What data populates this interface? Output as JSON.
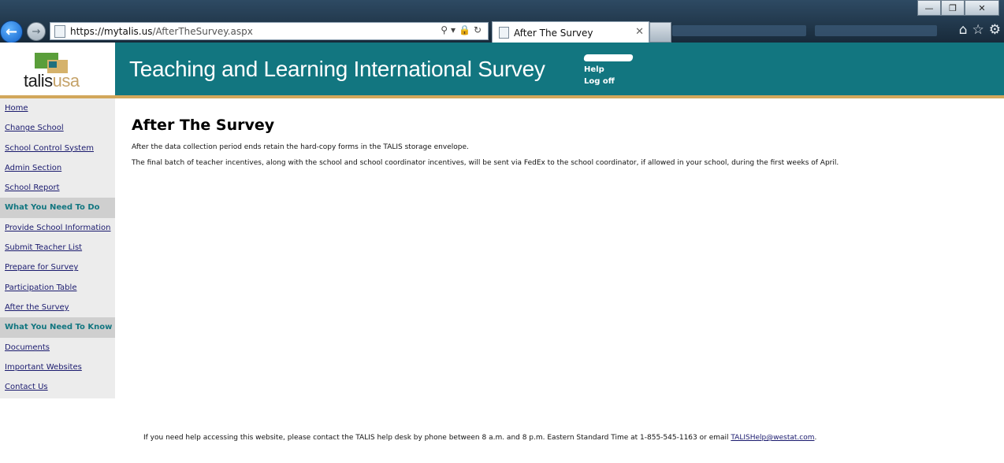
{
  "browser": {
    "url_host": "https://mytalis.us",
    "url_path": "/AfterTheSurvey.aspx",
    "tab_title": "After The Survey",
    "window_controls": [
      "minimize",
      "restore",
      "close"
    ],
    "toolbar_icons": [
      "home-icon",
      "star-icon",
      "gear-icon"
    ]
  },
  "logo": {
    "prefix": "talis",
    "suffix": "usa"
  },
  "header": {
    "title": "Teaching and Learning International Survey",
    "links": {
      "help": "Help",
      "logoff": "Log off"
    }
  },
  "sidebar": {
    "items": [
      {
        "label": "Home",
        "type": "link"
      },
      {
        "label": "Change School",
        "type": "link"
      },
      {
        "label": "School Control System",
        "type": "link"
      },
      {
        "label": "Admin Section",
        "type": "link"
      },
      {
        "label": "School Report",
        "type": "link"
      },
      {
        "label": "What You Need To Do",
        "type": "heading"
      },
      {
        "label": "Provide School Information",
        "type": "link"
      },
      {
        "label": "Submit Teacher List",
        "type": "link"
      },
      {
        "label": "Prepare for Survey",
        "type": "link"
      },
      {
        "label": "Participation Table",
        "type": "link"
      },
      {
        "label": "After the Survey",
        "type": "link"
      },
      {
        "label": "What You Need To Know",
        "type": "heading"
      },
      {
        "label": "Documents",
        "type": "link"
      },
      {
        "label": "Important Websites",
        "type": "link"
      },
      {
        "label": "Contact Us",
        "type": "link"
      }
    ]
  },
  "main": {
    "title": "After The Survey",
    "paragraphs": [
      "After the data collection period ends retain the hard-copy forms in the TALIS storage envelope.",
      "The final batch of teacher incentives, along with the school and school coordinator incentives, will be sent via FedEx to the school coordinator, if allowed in your school, during the first weeks of April."
    ]
  },
  "footer": {
    "text": "If you need help accessing this website, please contact the TALIS help desk by phone between 8 a.m. and 8 p.m. Eastern Standard Time at 1-855-545-1163 or email ",
    "email": "TALISHelp@westat.com",
    "end": "."
  },
  "colors": {
    "banner": "#127680",
    "gold": "#d2a75b",
    "sidebar": "#ececec",
    "heading": "#127680"
  }
}
